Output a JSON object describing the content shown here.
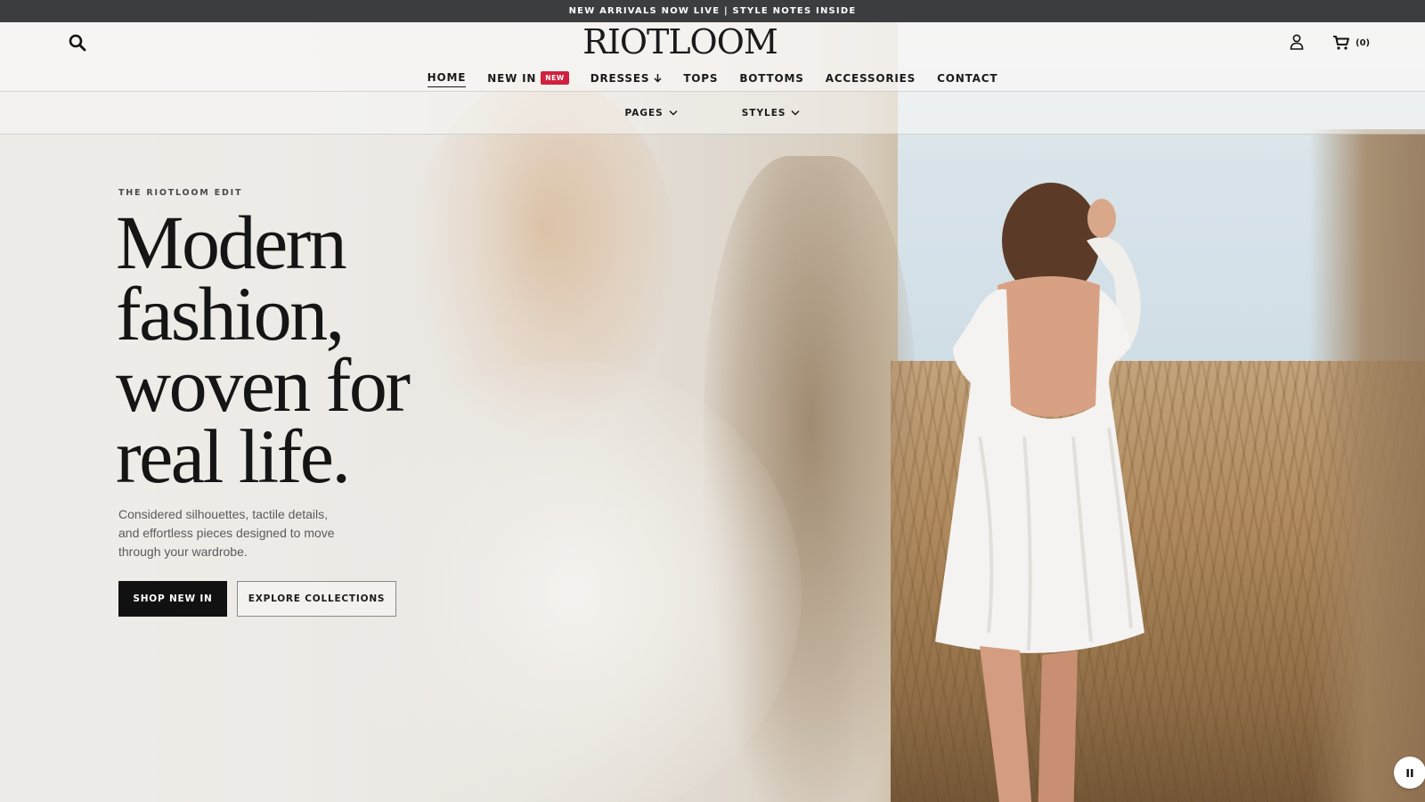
{
  "announcement": "NEW ARRIVALS NOW LIVE | STYLE NOTES INSIDE",
  "header": {
    "logo": "RIOTLOOM",
    "search_icon": "search-icon",
    "account_icon": "user-icon",
    "cart_icon": "cart-icon",
    "cart_count": "(0)"
  },
  "nav": {
    "items": [
      {
        "label": "HOME",
        "active": true
      },
      {
        "label": "NEW IN",
        "badge": "NEW"
      },
      {
        "label": "DRESSES",
        "icon": "arrow-down-icon"
      },
      {
        "label": "TOPS"
      },
      {
        "label": "BOTTOMS"
      },
      {
        "label": "ACCESSORIES"
      },
      {
        "label": "CONTACT"
      }
    ]
  },
  "subnav": {
    "items": [
      {
        "label": "PAGES",
        "icon": "chevron-down-icon"
      },
      {
        "label": "STYLES",
        "icon": "chevron-down-icon"
      }
    ]
  },
  "hero": {
    "eyebrow": "THE RIOTLOOM EDIT",
    "headline_lines": [
      "Modern",
      "fashion,",
      "woven for",
      "real life."
    ],
    "subcopy": "Considered silhouettes, tactile details, and effortless pieces designed to move through your wardrobe.",
    "primary_cta": "SHOP NEW IN",
    "secondary_cta": "EXPLORE COLLECTIONS",
    "pause_icon": "pause-icon"
  },
  "colors": {
    "announcement_bg": "#3c3d3f",
    "badge": "#d0213e",
    "primary_button": "#111111"
  }
}
